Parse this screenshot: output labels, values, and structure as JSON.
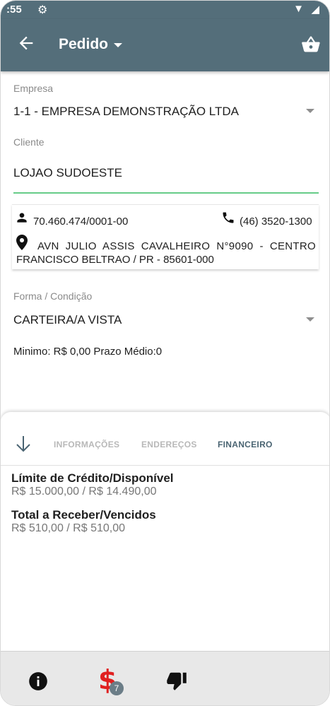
{
  "status_bar": {
    "time": ":55"
  },
  "app_bar": {
    "title": "Pedido"
  },
  "form": {
    "empresa_label": "Empresa",
    "empresa_value": "1-1 - EMPRESA DEMONSTRAÇÃO LTDA",
    "cliente_label": "Cliente",
    "cliente_value": "LOJAO SUDOESTE",
    "client_card": {
      "document": "70.460.474/0001-00",
      "phone": "(46) 3520-1300",
      "address_line1": "AVN JULIO ASSIS CAVALHEIRO N°9090 - CENTRO",
      "address_line2": "FRANCISCO BELTRAO / PR - 85601-000"
    },
    "forma_label": "Forma / Condição",
    "forma_value": "CARTEIRA/A VISTA",
    "minimo_text": "Minimo: R$ 0,00 Prazo Médio:0"
  },
  "tabs": [
    {
      "label": "INFORMAÇÕES"
    },
    {
      "label": "ENDEREÇOS"
    },
    {
      "label": "FINANCEIRO"
    }
  ],
  "financeiro": {
    "credit_label": "Límite de Crédito/Disponível",
    "credit_value": "R$ 15.000,00 / R$ 14.490,00",
    "receber_label": "Total a Receber/Vencidos",
    "receber_value": "R$ 510,00 / R$ 510,00"
  },
  "bottom_nav": {
    "badge_count": "7"
  },
  "colors": {
    "app_bar": "#546e7a",
    "accent_underline": "#66cc88",
    "dollar": "#e02020",
    "active_tab": "#4a6472"
  },
  "icons": [
    "settings-icon",
    "wifi-icon",
    "back-arrow-icon",
    "dropdown-caret-icon",
    "basket-icon",
    "person-icon",
    "phone-icon",
    "location-pin-icon",
    "arrow-down-icon",
    "info-icon",
    "dollar-icon",
    "thumbs-down-icon"
  ]
}
